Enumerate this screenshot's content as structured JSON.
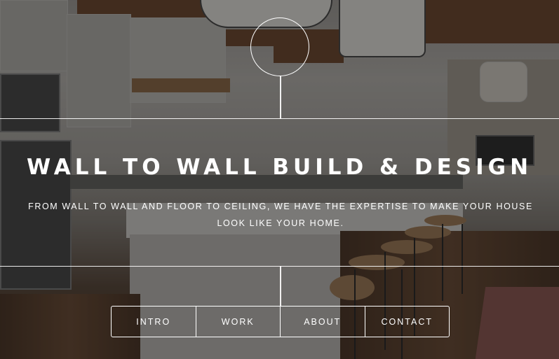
{
  "hero": {
    "title": "WALL TO WALL BUILD & DESIGN",
    "subtitle": "FROM WALL TO WALL AND FLOOR TO CEILING, WE HAVE THE EXPERTISE TO MAKE YOUR HOUSE LOOK LIKE YOUR HOME."
  },
  "nav": {
    "items": [
      {
        "label": "INTRO"
      },
      {
        "label": "WORK"
      },
      {
        "label": "ABOUT"
      },
      {
        "label": "CONTACT"
      }
    ]
  },
  "colors": {
    "text": "#ffffff",
    "lines": "#ffffff"
  }
}
